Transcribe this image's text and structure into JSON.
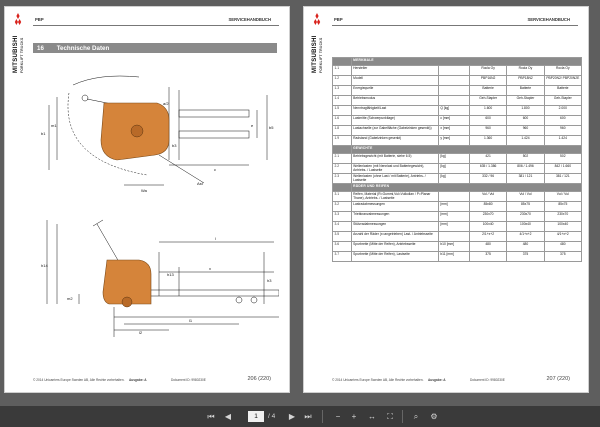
{
  "left_page": {
    "brand": "MITSUBISHI",
    "brand_sub": "FORKLIFT TRUCKS",
    "header_code": "PBP",
    "header_title": "SERVICEHANDBUCH",
    "section_number": "16",
    "section_title": "Technische Daten",
    "drawing_labels": {
      "top_view": [
        "m1",
        "m2",
        "l2",
        "x",
        "y",
        "b1",
        "b3",
        "b5",
        "e",
        "c",
        "a/2",
        "Wa",
        "Ast"
      ],
      "side_view": [
        "h14",
        "h13",
        "h3",
        "h1",
        "l2",
        "l1",
        "x",
        "s",
        "y",
        "m2"
      ]
    },
    "footer_copy": "© 2014 Unicarriers Europe Sweden AB, Alle Rechte vorbehalten.",
    "footer_edition": "Ausgabe: A",
    "footer_docid": "Dokument ID: 9980230E",
    "page_number": "206 (220)"
  },
  "right_page": {
    "brand": "MITSUBISHI",
    "brand_sub": "FORKLIFT TRUCKS",
    "header_code": "PBP",
    "header_title": "SERVICEHANDBUCH",
    "groups": [
      {
        "title": "MERKMALE",
        "rows": [
          {
            "num": "1.1",
            "label": "Hersteller",
            "unit": "",
            "v1": "Rocla Oy",
            "v2": "Rocla Oy",
            "v3": "Rocla Oy"
          },
          {
            "num": "1.2",
            "label": "Modell",
            "unit": "",
            "v1": "PBP16N2",
            "v2": "PBP18N2",
            "v3": "PBP20N2/ PBP20N2E"
          },
          {
            "num": "1.3",
            "label": "Energiequelle",
            "unit": "",
            "v1": "Batterie",
            "v2": "Batterie",
            "v3": "Batterie"
          },
          {
            "num": "1.4",
            "label": "Betriebsmodus",
            "unit": "",
            "v1": "Geh-Stapler",
            "v2": "Geh-Stapler",
            "v3": "Geh-Stapler"
          },
          {
            "num": "1.5",
            "label": "Nenntragfähigkeit/Last",
            "unit": "Q [kg]",
            "v1": "1.600",
            "v2": "1.800",
            "v3": "2.000"
          },
          {
            "num": "1.6",
            "label": "Lastmitte (Schwerpunktlage)",
            "unit": "c [mm]",
            "v1": "600",
            "v2": "600",
            "v3": "600"
          },
          {
            "num": "1.8",
            "label": "Lastachselle (zur Gabelfläche (Gabelzinken gesenkt))",
            "unit": "x [mm]",
            "v1": "960",
            "v2": "960",
            "v3": "960"
          },
          {
            "num": "1.9",
            "label": "Radstand (Gabelzinken gesenkt)",
            "unit": "y [mm]",
            "v1": "1.360",
            "v2": "1.424",
            "v3": "1.424"
          }
        ]
      },
      {
        "title": "GEWICHTE",
        "rows": [
          {
            "num": "2.1",
            "label": "Betriebsgewicht (mit Batterie, siehe 6.5)",
            "unit": "[kg]",
            "v1": "421",
            "v2": "502",
            "v3": "502"
          },
          {
            "num": "2.2",
            "label": "Wellenlasten (mit Nennlast und Batteriegewicht), Antriebs- / Lastseite",
            "unit": "[kg]",
            "v1": "635 / 1.386",
            "v2": "806 / 1.496",
            "v3": "842 / 1.660"
          },
          {
            "num": "2.3",
            "label": "Wellenlasten (ohne Last / mit Batterie), Antriebs- / Lastseite",
            "unit": "[kg]",
            "v1": "332 / 96",
            "v2": "381 / 121",
            "v3": "381 / 121"
          }
        ]
      },
      {
        "title": "RÄDER UND REIFEN",
        "rows": [
          {
            "num": "3.1",
            "label": "Reifen, Material (R=Gummi,Vul=Vulkollan / P=Planar Thane), Antriebs- / Lastseite",
            "unit": "",
            "v1": "Vul / Vul",
            "v2": "Vul / Vul",
            "v3": "Vul / Vul"
          },
          {
            "num": "3.2",
            "label": "Lastradabmessungen",
            "unit": "[mm]",
            "v1": "85x80",
            "v2": "85x75",
            "v3": "85x75"
          },
          {
            "num": "3.3",
            "label": "Triebkranzabmessungen",
            "unit": "[mm]",
            "v1": "230x70",
            "v2": "230x70",
            "v3": "230x70"
          },
          {
            "num": "3.4",
            "label": "Stützradabmessungen",
            "unit": "[mm]",
            "v1": "100x40",
            "v2": "100x40",
            "v3": "100x40"
          },
          {
            "num": "3.5",
            "label": "Anzahl der Räder (x=angetrieben) Last- / Antriebsseite",
            "unit": "",
            "v1": "2/1+x+2",
            "v2": "4/1+x+2",
            "v3": "4/1+x+2"
          },
          {
            "num": "3.6",
            "label": "Spurbreite (Mitte der Reifen), Antriebsseite",
            "unit": "b10 [mm]",
            "v1": "480",
            "v2": "480",
            "v3": "480"
          },
          {
            "num": "3.7",
            "label": "Spurbreite (Mitte der Reifen), Lastseite",
            "unit": "b11 [mm]",
            "v1": "375",
            "v2": "375",
            "v3": "375"
          }
        ]
      }
    ],
    "footer_copy": "© 2014 Unicarriers Europe Sweden AB, Alle Rechte vorbehalten.",
    "footer_edition": "Ausgabe: A",
    "footer_docid": "Dokument ID: 9980230E",
    "page_number": "207 (220)"
  },
  "toolbar": {
    "current_page": "1",
    "total_pages": "/ 4",
    "buttons": [
      "first-page",
      "prev-page",
      "next-page",
      "last-page",
      "zoom-out",
      "zoom-in",
      "fit-width",
      "fullscreen",
      "search",
      "settings"
    ]
  },
  "colors": {
    "section_band": "#8a8a8a",
    "viewer_bg": "#5e5e5e",
    "toolbar_bg": "#3a3a3a",
    "truck_body": "#d5843a",
    "logo_red": "#d9231d"
  }
}
